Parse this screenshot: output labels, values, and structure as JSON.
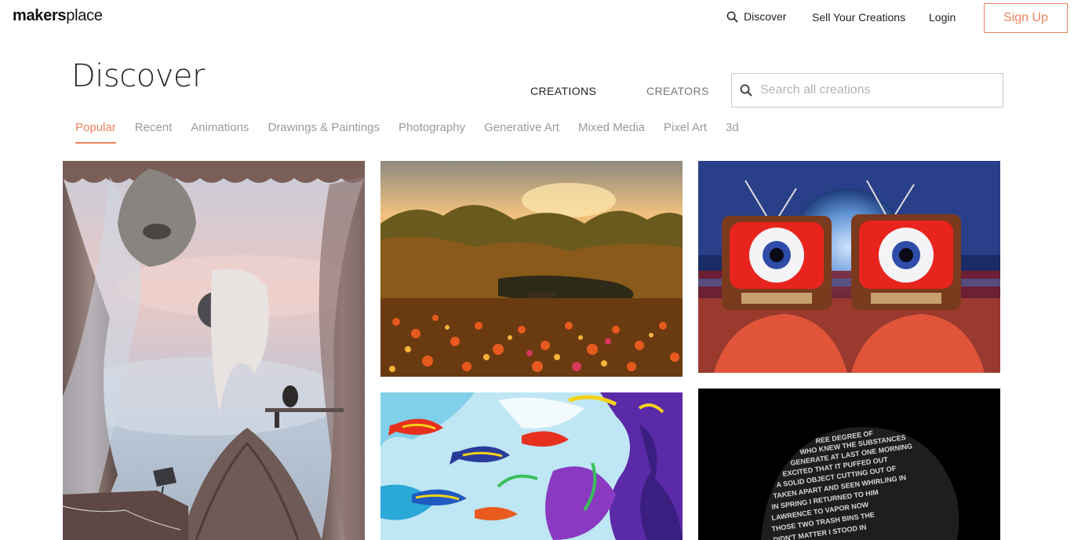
{
  "header": {
    "logo_bold": "makers",
    "logo_light": "place",
    "nav": {
      "discover": "Discover",
      "sell": "Sell Your Creations",
      "login": "Login",
      "signup": "Sign Up"
    },
    "accent_color": "#f0835c"
  },
  "main": {
    "title": "Discover",
    "toggle": {
      "creations": "CREATIONS",
      "creators": "CREATORS",
      "active": "creations"
    },
    "search": {
      "placeholder": "Search all creations",
      "value": ""
    },
    "categories": [
      "Popular",
      "Recent",
      "Animations",
      "Drawings & Paintings",
      "Photography",
      "Generative Art",
      "Mixed Media",
      "Pixel Art",
      "3d"
    ],
    "active_category": "Popular"
  },
  "gallery": {
    "items": [
      {
        "description_icon": "surreal-curtain-artwork"
      },
      {
        "description_icon": "sunset-flower-field-artwork"
      },
      {
        "description_icon": "tv-head-eyeball-artwork"
      },
      {
        "description_icon": "abstract-fish-artwork"
      },
      {
        "description_icon": "typographic-portrait-artwork"
      }
    ]
  },
  "icons": {
    "search": "search-icon"
  }
}
